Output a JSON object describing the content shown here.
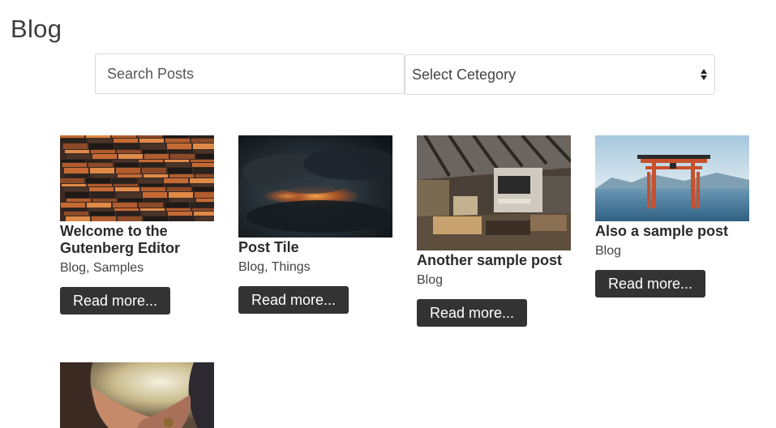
{
  "page": {
    "title": "Blog"
  },
  "filters": {
    "search_placeholder": "Search Posts",
    "category_selected": "Select Cetegory"
  },
  "posts": [
    {
      "title": "Welcome to the Gutenberg Editor",
      "categories": "Blog, Samples",
      "read_more": "Read more...",
      "image": "wood-stripes-photo"
    },
    {
      "title": "Post Tile",
      "categories": "Blog, Things",
      "read_more": "Read more...",
      "image": "stormy-sky-photo"
    },
    {
      "title": "Another sample post",
      "categories": "Blog",
      "read_more": "Read more...",
      "image": "lobby-interior-photo"
    },
    {
      "title": "Also a sample post",
      "categories": "Blog",
      "read_more": "Read more...",
      "image": "torii-gate-photo"
    },
    {
      "image": "holding-hands-photo"
    }
  ],
  "colors": {
    "button_bg": "#333333",
    "button_text": "#ffffff",
    "title_text": "#2b2b2b",
    "border": "#d9d9d9"
  }
}
